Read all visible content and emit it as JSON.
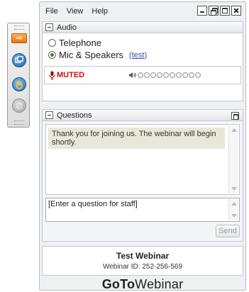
{
  "menu": {
    "items": [
      "File",
      "View",
      "Help"
    ]
  },
  "window_controls": [
    "minimize",
    "restore",
    "maximize",
    "close"
  ],
  "toolbar": {
    "icons": [
      "arrow-icon",
      "screen-share-icon",
      "raise-hand-icon",
      "disabled-icon"
    ]
  },
  "audio": {
    "title": "Audio",
    "options": [
      {
        "label": "Telephone",
        "selected": false
      },
      {
        "label": "Mic & Speakers",
        "selected": true
      }
    ],
    "test_link": "(test)",
    "mute_status": "MUTED",
    "speaker_level": 0
  },
  "questions": {
    "title": "Questions",
    "messages": [
      "Thank you for joining us. The webinar will begin shortly."
    ],
    "input_value": "[Enter a question for staff]",
    "send_label": "Send"
  },
  "webinar": {
    "title": "Test Webinar",
    "id_line": "Webinar ID: 252-256-569"
  },
  "brand": {
    "bold": "GoTo",
    "regular": "Webinar"
  },
  "colors": {
    "accent_orange": "#e8740b",
    "muted_red": "#cc1111",
    "link_blue": "#2a4fb5",
    "message_bg": "#e7e8d8"
  }
}
